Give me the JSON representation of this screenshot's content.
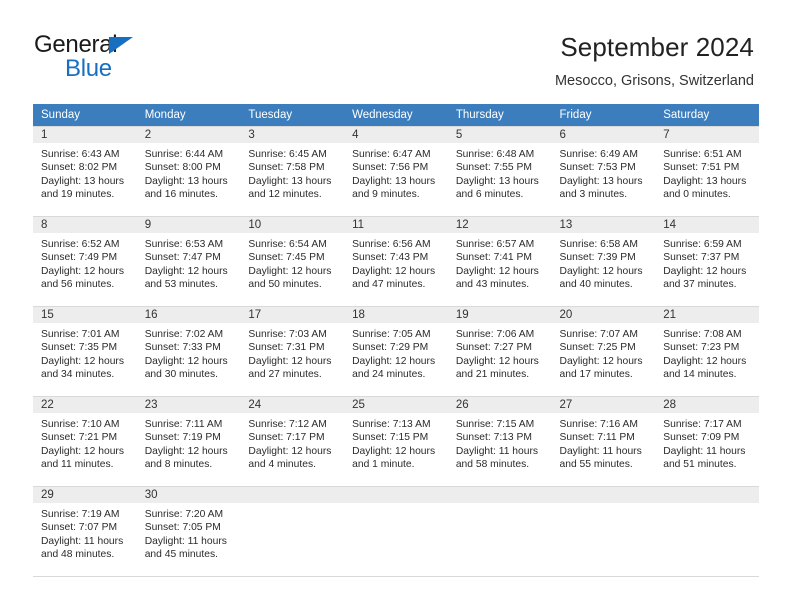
{
  "brand": {
    "name_top": "General",
    "name_bottom": "Blue",
    "accent_color": "#176fc1",
    "triangle_icon": "logo-triangle-icon"
  },
  "header": {
    "title": "September 2024",
    "subtitle": "Mesocco, Grisons, Switzerland"
  },
  "theme": {
    "header_row_bg": "#3b7dbd",
    "daynum_band_bg": "#ededed",
    "grid_line": "#d9d9d9",
    "text": "#2b2b2b"
  },
  "weekday_headers": [
    "Sunday",
    "Monday",
    "Tuesday",
    "Wednesday",
    "Thursday",
    "Friday",
    "Saturday"
  ],
  "labels": {
    "sunrise": "Sunrise:",
    "sunset": "Sunset:",
    "daylight": "Daylight:"
  },
  "weeks": [
    [
      {
        "day": "1",
        "sunrise": "Sunrise: 6:43 AM",
        "sunset": "Sunset: 8:02 PM",
        "daylight_1": "Daylight: 13 hours",
        "daylight_2": "and 19 minutes."
      },
      {
        "day": "2",
        "sunrise": "Sunrise: 6:44 AM",
        "sunset": "Sunset: 8:00 PM",
        "daylight_1": "Daylight: 13 hours",
        "daylight_2": "and 16 minutes."
      },
      {
        "day": "3",
        "sunrise": "Sunrise: 6:45 AM",
        "sunset": "Sunset: 7:58 PM",
        "daylight_1": "Daylight: 13 hours",
        "daylight_2": "and 12 minutes."
      },
      {
        "day": "4",
        "sunrise": "Sunrise: 6:47 AM",
        "sunset": "Sunset: 7:56 PM",
        "daylight_1": "Daylight: 13 hours",
        "daylight_2": "and 9 minutes."
      },
      {
        "day": "5",
        "sunrise": "Sunrise: 6:48 AM",
        "sunset": "Sunset: 7:55 PM",
        "daylight_1": "Daylight: 13 hours",
        "daylight_2": "and 6 minutes."
      },
      {
        "day": "6",
        "sunrise": "Sunrise: 6:49 AM",
        "sunset": "Sunset: 7:53 PM",
        "daylight_1": "Daylight: 13 hours",
        "daylight_2": "and 3 minutes."
      },
      {
        "day": "7",
        "sunrise": "Sunrise: 6:51 AM",
        "sunset": "Sunset: 7:51 PM",
        "daylight_1": "Daylight: 13 hours",
        "daylight_2": "and 0 minutes."
      }
    ],
    [
      {
        "day": "8",
        "sunrise": "Sunrise: 6:52 AM",
        "sunset": "Sunset: 7:49 PM",
        "daylight_1": "Daylight: 12 hours",
        "daylight_2": "and 56 minutes."
      },
      {
        "day": "9",
        "sunrise": "Sunrise: 6:53 AM",
        "sunset": "Sunset: 7:47 PM",
        "daylight_1": "Daylight: 12 hours",
        "daylight_2": "and 53 minutes."
      },
      {
        "day": "10",
        "sunrise": "Sunrise: 6:54 AM",
        "sunset": "Sunset: 7:45 PM",
        "daylight_1": "Daylight: 12 hours",
        "daylight_2": "and 50 minutes."
      },
      {
        "day": "11",
        "sunrise": "Sunrise: 6:56 AM",
        "sunset": "Sunset: 7:43 PM",
        "daylight_1": "Daylight: 12 hours",
        "daylight_2": "and 47 minutes."
      },
      {
        "day": "12",
        "sunrise": "Sunrise: 6:57 AM",
        "sunset": "Sunset: 7:41 PM",
        "daylight_1": "Daylight: 12 hours",
        "daylight_2": "and 43 minutes."
      },
      {
        "day": "13",
        "sunrise": "Sunrise: 6:58 AM",
        "sunset": "Sunset: 7:39 PM",
        "daylight_1": "Daylight: 12 hours",
        "daylight_2": "and 40 minutes."
      },
      {
        "day": "14",
        "sunrise": "Sunrise: 6:59 AM",
        "sunset": "Sunset: 7:37 PM",
        "daylight_1": "Daylight: 12 hours",
        "daylight_2": "and 37 minutes."
      }
    ],
    [
      {
        "day": "15",
        "sunrise": "Sunrise: 7:01 AM",
        "sunset": "Sunset: 7:35 PM",
        "daylight_1": "Daylight: 12 hours",
        "daylight_2": "and 34 minutes."
      },
      {
        "day": "16",
        "sunrise": "Sunrise: 7:02 AM",
        "sunset": "Sunset: 7:33 PM",
        "daylight_1": "Daylight: 12 hours",
        "daylight_2": "and 30 minutes."
      },
      {
        "day": "17",
        "sunrise": "Sunrise: 7:03 AM",
        "sunset": "Sunset: 7:31 PM",
        "daylight_1": "Daylight: 12 hours",
        "daylight_2": "and 27 minutes."
      },
      {
        "day": "18",
        "sunrise": "Sunrise: 7:05 AM",
        "sunset": "Sunset: 7:29 PM",
        "daylight_1": "Daylight: 12 hours",
        "daylight_2": "and 24 minutes."
      },
      {
        "day": "19",
        "sunrise": "Sunrise: 7:06 AM",
        "sunset": "Sunset: 7:27 PM",
        "daylight_1": "Daylight: 12 hours",
        "daylight_2": "and 21 minutes."
      },
      {
        "day": "20",
        "sunrise": "Sunrise: 7:07 AM",
        "sunset": "Sunset: 7:25 PM",
        "daylight_1": "Daylight: 12 hours",
        "daylight_2": "and 17 minutes."
      },
      {
        "day": "21",
        "sunrise": "Sunrise: 7:08 AM",
        "sunset": "Sunset: 7:23 PM",
        "daylight_1": "Daylight: 12 hours",
        "daylight_2": "and 14 minutes."
      }
    ],
    [
      {
        "day": "22",
        "sunrise": "Sunrise: 7:10 AM",
        "sunset": "Sunset: 7:21 PM",
        "daylight_1": "Daylight: 12 hours",
        "daylight_2": "and 11 minutes."
      },
      {
        "day": "23",
        "sunrise": "Sunrise: 7:11 AM",
        "sunset": "Sunset: 7:19 PM",
        "daylight_1": "Daylight: 12 hours",
        "daylight_2": "and 8 minutes."
      },
      {
        "day": "24",
        "sunrise": "Sunrise: 7:12 AM",
        "sunset": "Sunset: 7:17 PM",
        "daylight_1": "Daylight: 12 hours",
        "daylight_2": "and 4 minutes."
      },
      {
        "day": "25",
        "sunrise": "Sunrise: 7:13 AM",
        "sunset": "Sunset: 7:15 PM",
        "daylight_1": "Daylight: 12 hours",
        "daylight_2": "and 1 minute."
      },
      {
        "day": "26",
        "sunrise": "Sunrise: 7:15 AM",
        "sunset": "Sunset: 7:13 PM",
        "daylight_1": "Daylight: 11 hours",
        "daylight_2": "and 58 minutes."
      },
      {
        "day": "27",
        "sunrise": "Sunrise: 7:16 AM",
        "sunset": "Sunset: 7:11 PM",
        "daylight_1": "Daylight: 11 hours",
        "daylight_2": "and 55 minutes."
      },
      {
        "day": "28",
        "sunrise": "Sunrise: 7:17 AM",
        "sunset": "Sunset: 7:09 PM",
        "daylight_1": "Daylight: 11 hours",
        "daylight_2": "and 51 minutes."
      }
    ],
    [
      {
        "day": "29",
        "sunrise": "Sunrise: 7:19 AM",
        "sunset": "Sunset: 7:07 PM",
        "daylight_1": "Daylight: 11 hours",
        "daylight_2": "and 48 minutes."
      },
      {
        "day": "30",
        "sunrise": "Sunrise: 7:20 AM",
        "sunset": "Sunset: 7:05 PM",
        "daylight_1": "Daylight: 11 hours",
        "daylight_2": "and 45 minutes."
      },
      {
        "day": "",
        "sunrise": "",
        "sunset": "",
        "daylight_1": "",
        "daylight_2": ""
      },
      {
        "day": "",
        "sunrise": "",
        "sunset": "",
        "daylight_1": "",
        "daylight_2": ""
      },
      {
        "day": "",
        "sunrise": "",
        "sunset": "",
        "daylight_1": "",
        "daylight_2": ""
      },
      {
        "day": "",
        "sunrise": "",
        "sunset": "",
        "daylight_1": "",
        "daylight_2": ""
      },
      {
        "day": "",
        "sunrise": "",
        "sunset": "",
        "daylight_1": "",
        "daylight_2": ""
      }
    ]
  ]
}
